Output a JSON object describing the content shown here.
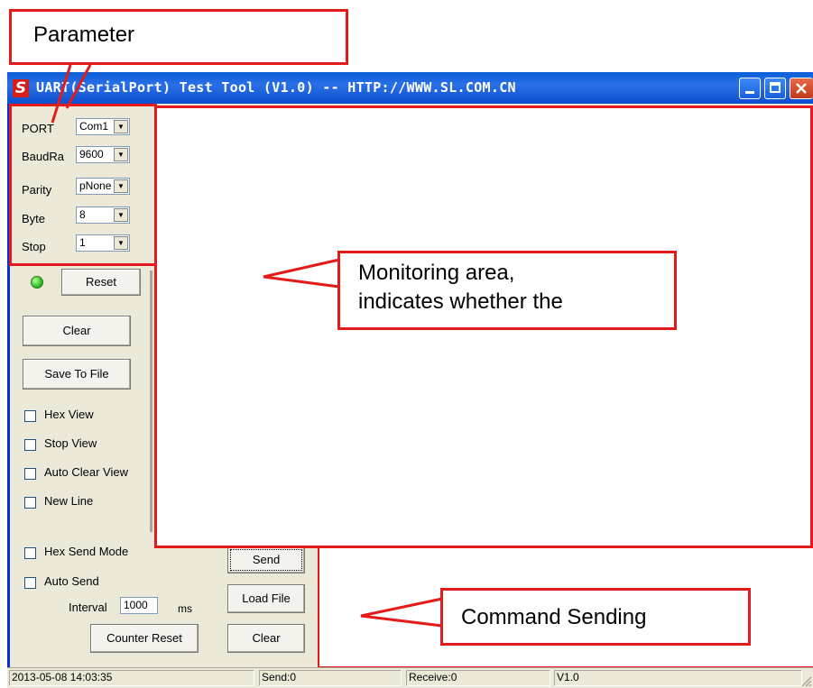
{
  "window": {
    "title": "UART(SerialPort) Test Tool (V1.0) -- HTTP://WWW.SL.COM.CN",
    "app_icon_letter": "S"
  },
  "params": {
    "port_label": "PORT",
    "port_value": "Com1",
    "baud_label": "BaudRa",
    "baud_value": "9600",
    "parity_label": "Parity",
    "parity_value": "pNone",
    "byte_label": "Byte",
    "byte_value": "8",
    "stop_label": "Stop",
    "stop_value": "1"
  },
  "left": {
    "reset_label": "Reset",
    "clear_label": "Clear",
    "save_label": "Save To File",
    "hex_view": "Hex View",
    "stop_view": "Stop View",
    "auto_clear_view": "Auto Clear View",
    "new_line": "New Line",
    "hex_send_mode": "Hex Send Mode",
    "auto_send": "Auto Send",
    "interval_label": "Interval",
    "interval_value": "1000",
    "interval_unit": "ms",
    "counter_reset_label": "Counter Reset"
  },
  "sendbuttons": {
    "send_label": "Send",
    "load_label": "Load File",
    "clear_label": "Clear"
  },
  "status": {
    "datetime": "2013-05-08 14:03:35",
    "send": "Send:0",
    "receive": "Receive:0",
    "version": "V1.0"
  },
  "callouts": {
    "parameter": "Parameter",
    "monitoring_line1": "Monitoring area,",
    "monitoring_line2": "indicates whether the",
    "command": "Command Sending"
  },
  "colors": {
    "callout_red": "#e31b1b",
    "titlebar_blue": "#0a5fd8",
    "led_green": "#1eb015"
  }
}
